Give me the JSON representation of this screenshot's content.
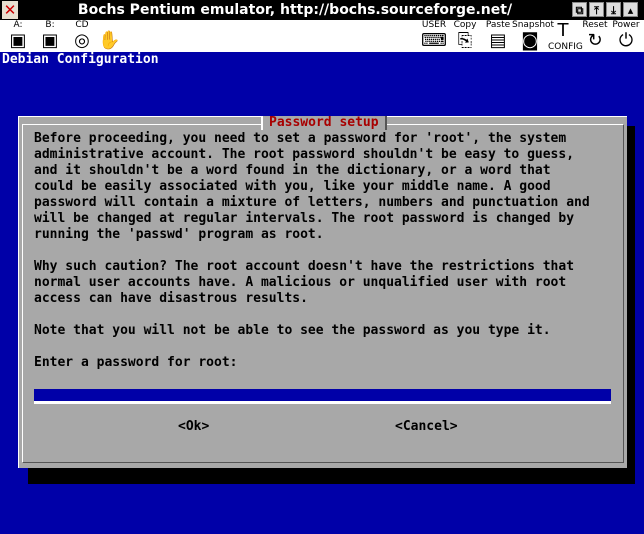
{
  "window": {
    "title": "Bochs Pentium emulator, http://bochs.sourceforge.net/"
  },
  "toolbar": {
    "drive_a_label": "A:",
    "drive_b_label": "B:",
    "cdrom_label": "CD",
    "user_label": "USER",
    "copy_label": "Copy",
    "paste_label": "Paste",
    "snapshot_label": "Snapshot",
    "config_label": "CONFIG",
    "reset_label": "Reset",
    "power_label": "Power"
  },
  "screen": {
    "header": "Debian Configuration"
  },
  "dialog": {
    "title": "Password setup",
    "para1": "Before proceeding, you need to set a password for 'root', the system\nadministrative account. The root password shouldn't be easy to guess,\nand it shouldn't be a word found in the dictionary, or a word that\ncould be easily associated with you, like your middle name. A good\npassword will contain a mixture of letters, numbers and punctuation and\nwill be changed at regular intervals. The root password is changed by\nrunning the 'passwd' program as root.",
    "para2": "Why such caution? The root account doesn't have the restrictions that\nnormal user accounts have. A malicious or unqualified user with root\naccess can have disastrous results.",
    "para3": "Note that you will not be able to see the password as you type it.",
    "prompt": "Enter a password for root:",
    "password_value": "",
    "ok_label": "<Ok>",
    "cancel_label": "<Cancel>"
  },
  "colors": {
    "screen_bg": "#0000a8",
    "dialog_bg": "#a8a8a8",
    "title_red": "#a80000"
  }
}
